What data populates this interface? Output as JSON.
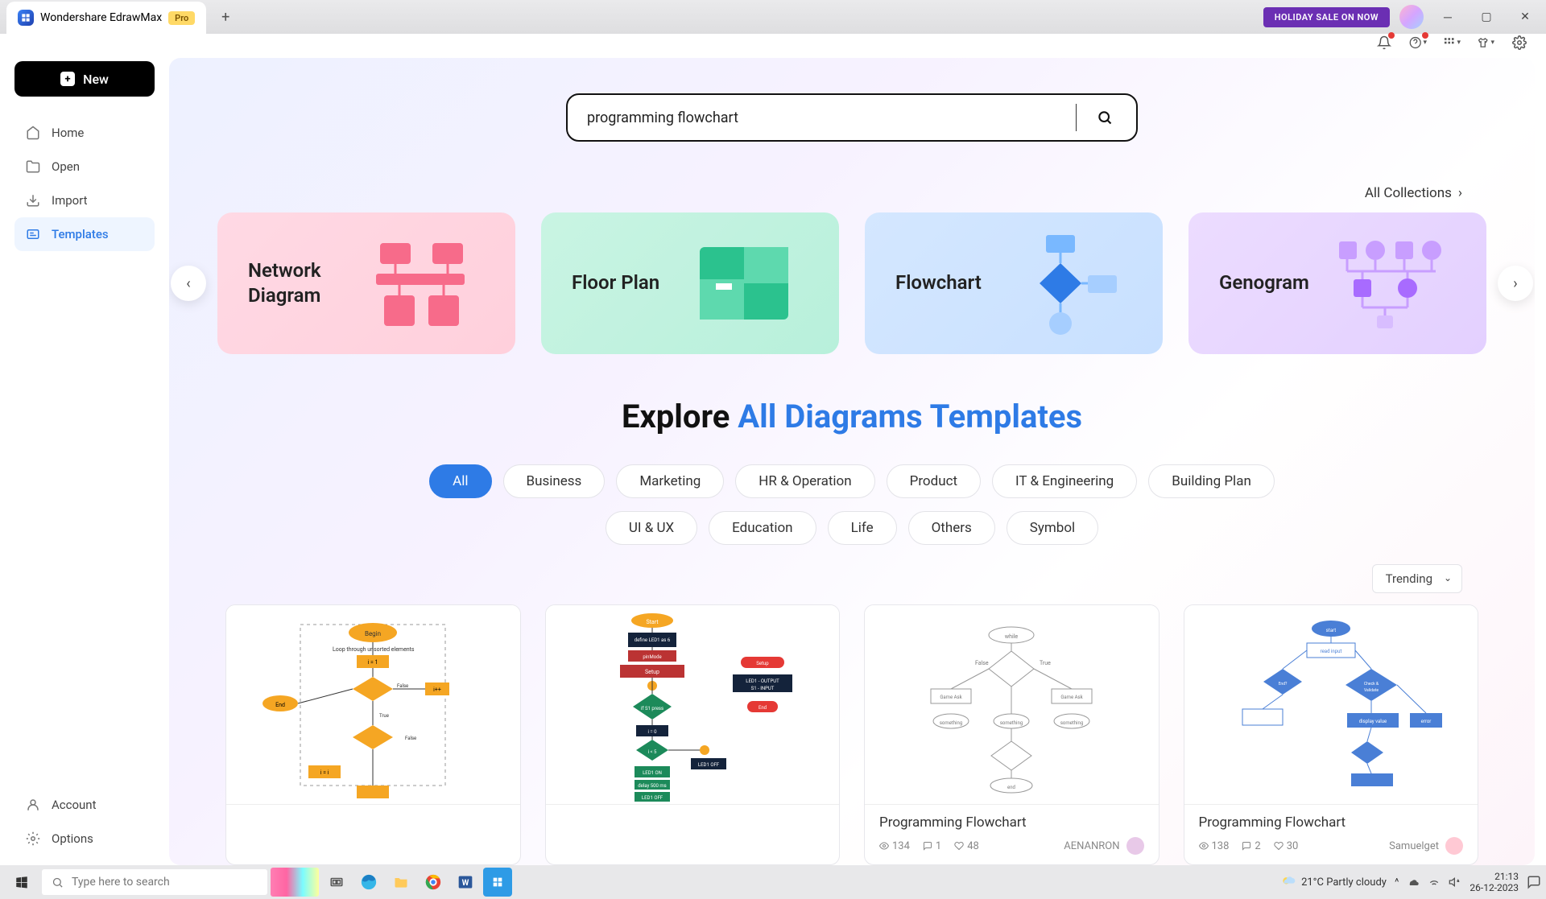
{
  "app": {
    "title": "Wondershare EdrawMax",
    "pro_badge": "Pro"
  },
  "titlebar": {
    "holiday": "HOLIDAY SALE ON NOW"
  },
  "sidebar": {
    "new_label": "New",
    "items": [
      {
        "label": "Home"
      },
      {
        "label": "Open"
      },
      {
        "label": "Import"
      },
      {
        "label": "Templates"
      }
    ],
    "bottom": [
      {
        "label": "Account"
      },
      {
        "label": "Options"
      }
    ]
  },
  "search": {
    "value": "programming flowchart"
  },
  "all_collections": "All Collections",
  "categories": [
    {
      "title": "Network\nDiagram"
    },
    {
      "title": "Floor  Plan"
    },
    {
      "title": "Flowchart"
    },
    {
      "title": "Genogram"
    }
  ],
  "explore": {
    "black": "Explore ",
    "blue": "All Diagrams Templates"
  },
  "filters_row1": [
    "All",
    "Business",
    "Marketing",
    "HR & Operation",
    "Product",
    "IT & Engineering",
    "Building Plan"
  ],
  "filters_row2": [
    "UI & UX",
    "Education",
    "Life",
    "Others",
    "Symbol"
  ],
  "sort": {
    "label": "Trending"
  },
  "templates": [
    {
      "title": "",
      "views": "",
      "comments": "",
      "likes": "",
      "author": ""
    },
    {
      "title": "",
      "views": "",
      "comments": "",
      "likes": "",
      "author": ""
    },
    {
      "title": "Programming Flowchart",
      "views": "134",
      "comments": "1",
      "likes": "48",
      "author": "AENANRON"
    },
    {
      "title": "Programming Flowchart",
      "views": "138",
      "comments": "2",
      "likes": "30",
      "author": "Samuelget"
    }
  ],
  "taskbar": {
    "search_placeholder": "Type here to search",
    "weather": "21°C  Partly cloudy",
    "time": "21:13",
    "date": "26-12-2023"
  }
}
